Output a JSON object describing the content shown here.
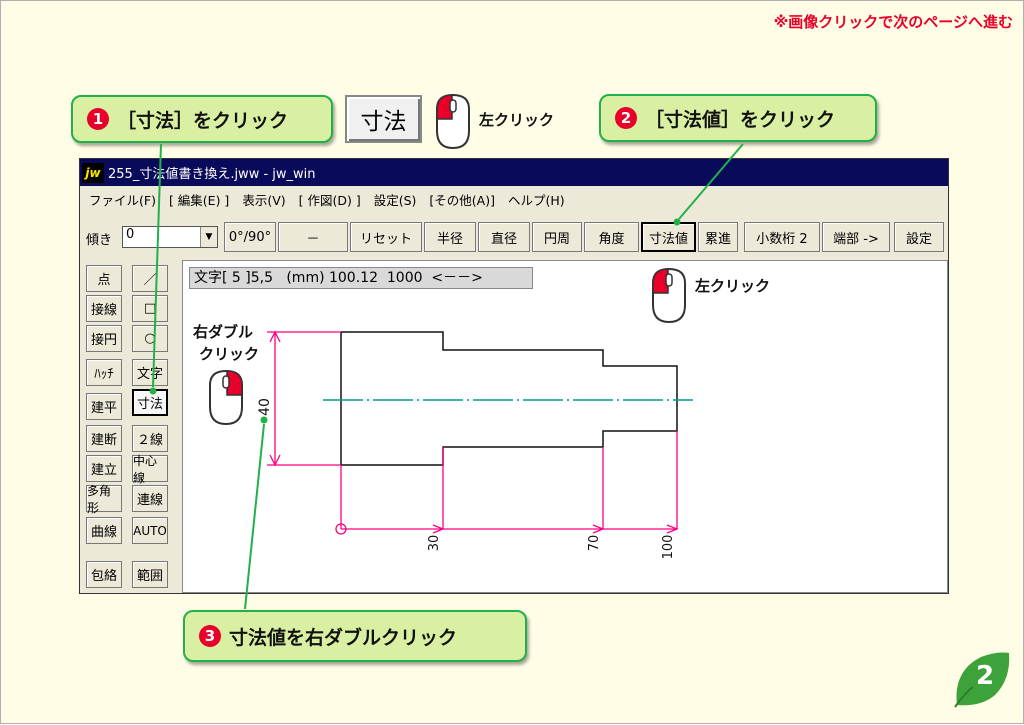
{
  "page": {
    "next_page_note": "※画像クリックで次のページへ進む",
    "page_number": "2"
  },
  "callouts": {
    "step1": {
      "num": "1",
      "text": "［寸法］をクリック"
    },
    "step2": {
      "num": "2",
      "text": "［寸法値］をクリック"
    },
    "step3": {
      "num": "3",
      "text": "寸法値を右ダブルクリック"
    }
  },
  "big_button": {
    "label": "寸法"
  },
  "labels": {
    "left_click_1": "左クリック",
    "left_click_2": "左クリック",
    "right_double_line1": "右ダブル",
    "right_double_line2": "クリック"
  },
  "window": {
    "title": "255_寸法値書き換え.jww - jw_win",
    "logo": "jw",
    "menu": [
      "ファイル(F)",
      "[ 編集(E) ]",
      "表示(V)",
      "[ 作図(D) ]",
      "設定(S)",
      "[その他(A)]",
      "ヘルプ(H)"
    ],
    "toolbar": {
      "tilt_label": "傾き",
      "tilt_value": "0",
      "buttons": [
        "0°/90°",
        "－",
        "リセット",
        "半径",
        "直径",
        "円周",
        "角度",
        "寸法値",
        "累進",
        "小数桁 2",
        "端部 ->",
        "設定"
      ]
    },
    "left_tools": [
      [
        "点",
        "／"
      ],
      [
        "接線",
        "□"
      ],
      [
        "接円",
        "○"
      ],
      [
        "ﾊｯﾁ",
        "文字"
      ],
      [
        "建平",
        "寸法"
      ],
      [
        "建断",
        "２線"
      ],
      [
        "建立",
        "中心線"
      ],
      [
        "多角形",
        "連線"
      ],
      [
        "曲線",
        "AUTO"
      ],
      [
        "包絡",
        "範囲"
      ]
    ],
    "status_text": "文字[ 5 ]5,5   (mm) 100.12  1000  <－－>",
    "dims": {
      "vertical": "40",
      "d1": "30",
      "d2": "70",
      "d3": "100"
    }
  },
  "colors": {
    "accent_red": "#e8002a",
    "callout_green": "#22b04b",
    "callout_fill": "#d9f0a3",
    "dim_magenta": "#ff0080",
    "center_teal": "#009c8c"
  }
}
